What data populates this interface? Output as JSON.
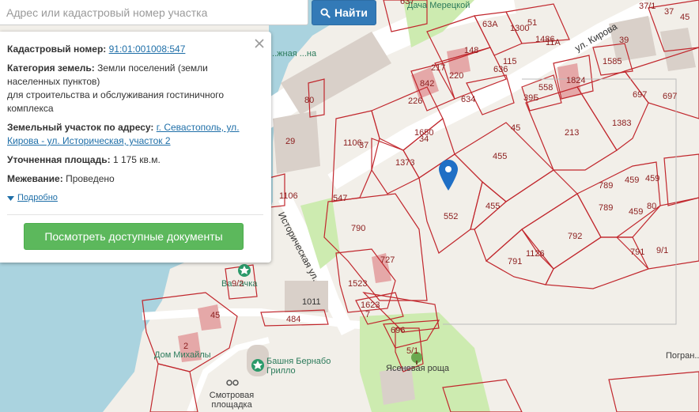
{
  "search": {
    "placeholder": "Адрес или кадастровый номер участка",
    "button_label": "Найти"
  },
  "popup": {
    "cadastral_label": "Кадастровый номер:",
    "cadastral_value": "91:01:001008:547",
    "category_label": "Категория земель:",
    "category_value": "Земли поселений (земли населенных пунктов)",
    "category_purpose": "для строительства и обслуживания гостиничного комплекса",
    "address_label": "Земельный участок по адресу:",
    "address_value": "г. Севастополь, ул. Кирова - ул. Историческая, участок 2",
    "area_label": "Уточненная площадь:",
    "area_value": "1 175 кв.м.",
    "survey_label": "Межевание:",
    "survey_value": "Проведено",
    "more_label": "Подробно",
    "docs_button": "Посмотреть доступные документы"
  },
  "map": {
    "streets": [
      "ул. Кирова",
      "Историческая ул."
    ],
    "places": [
      "Дача Мерецкой",
      "Башня Бернабо Грилло",
      "Ясеневая роща",
      "Смотровая площадка",
      "Дом Михайлы",
      "Ва...ачка",
      "Погран...",
      "...жная ...на"
    ],
    "parcel_labels": [
      "637",
      "1300",
      "51",
      "148",
      "63А",
      "1486",
      "11А",
      "ул.",
      "39",
      "37/1",
      "37",
      "45",
      "217",
      "220",
      "842",
      "636",
      "115",
      "1585",
      "226",
      "634",
      "39Б",
      "558",
      "1824",
      "697",
      "697",
      "80",
      "45",
      "213",
      "1383",
      "1650",
      "34",
      "29",
      "1106",
      "37",
      "1373",
      "455",
      "455",
      "789",
      "459",
      "459",
      "789",
      "459",
      "80",
      "1106",
      "547",
      "552",
      "790",
      "792",
      "1126",
      "791",
      "791",
      "9/1",
      "727",
      "1523",
      "9/2",
      "1623",
      "7",
      "1011",
      "484",
      "696",
      "5/1",
      "45",
      "2"
    ],
    "accent_color": "#337ab7",
    "parcel_color": "#c1272d",
    "marker_color": "#1f6fc5"
  }
}
